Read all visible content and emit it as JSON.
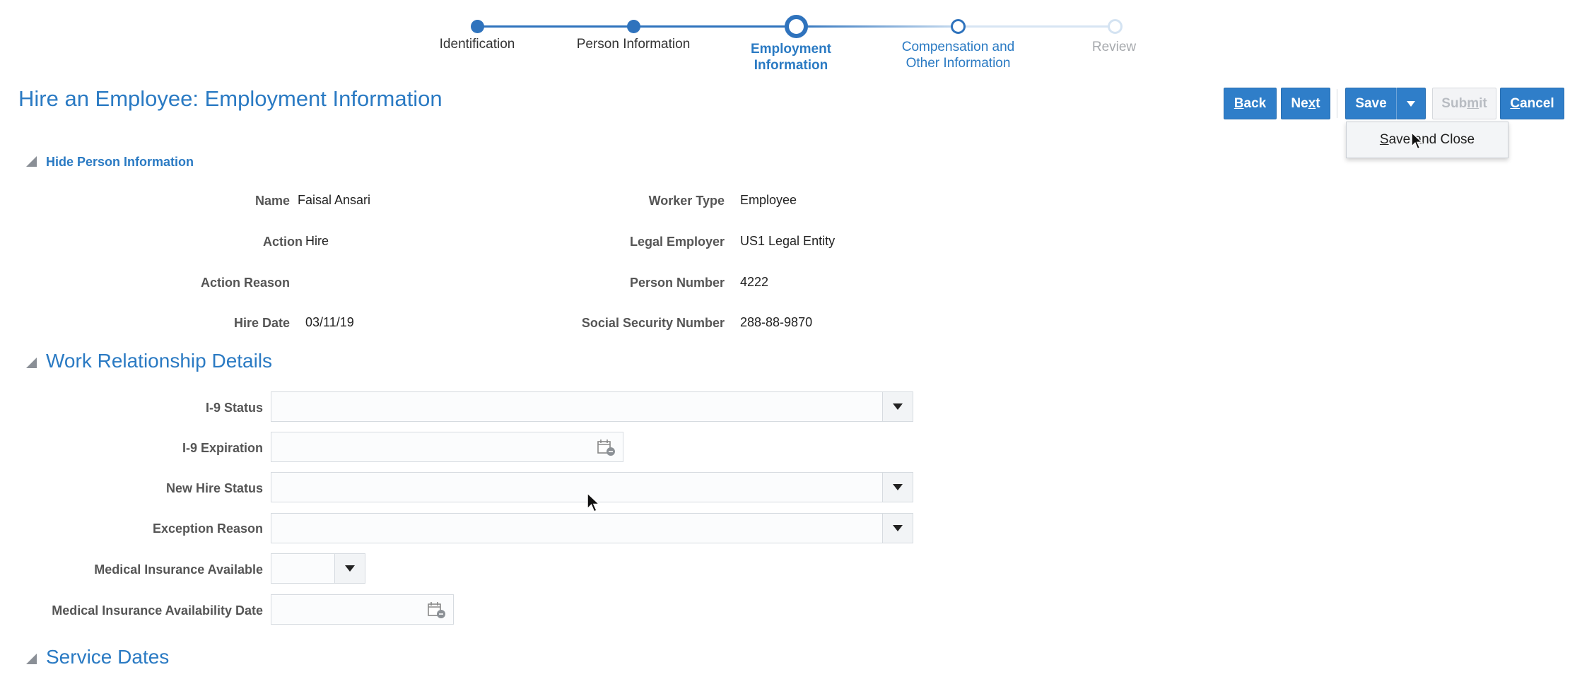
{
  "train": {
    "steps": [
      {
        "label": "Identification",
        "state": "done"
      },
      {
        "label": "Person Information",
        "state": "done"
      },
      {
        "label_line1": "Employment",
        "label_line2": "Information",
        "state": "current"
      },
      {
        "label_line1": "Compensation and",
        "label_line2": "Other Information",
        "state": "next"
      },
      {
        "label": "Review",
        "state": "disabled"
      }
    ]
  },
  "page": {
    "title": "Hire an Employee: Employment Information"
  },
  "toolbar": {
    "back": {
      "pre": "",
      "ul": "B",
      "post": "ack"
    },
    "next": {
      "pre": "Ne",
      "ul": "x",
      "post": "t"
    },
    "save": "Save",
    "submit": {
      "pre": "Sub",
      "ul": "m",
      "post": "it"
    },
    "cancel": {
      "pre": "",
      "ul": "C",
      "post": "ancel"
    },
    "save_menu": {
      "ul": "S",
      "post": "ave and Close"
    }
  },
  "person_section": {
    "toggle_label": "Hide Person Information",
    "left": [
      {
        "label": "Name",
        "value": "Faisal Ansari"
      },
      {
        "label": "Action",
        "value": "Hire"
      },
      {
        "label": "Action Reason",
        "value": ""
      },
      {
        "label": "Hire Date",
        "value": "03/11/19"
      }
    ],
    "right": [
      {
        "label": "Worker Type",
        "value": "Employee"
      },
      {
        "label": "Legal Employer",
        "value": "US1 Legal Entity"
      },
      {
        "label": "Person Number",
        "value": "4222"
      },
      {
        "label": "Social Security Number",
        "value": "288-88-9870"
      }
    ]
  },
  "work_relationship": {
    "heading": "Work Relationship Details",
    "fields": [
      {
        "label": "I-9 Status",
        "value": ""
      },
      {
        "label": "I-9 Expiration",
        "value": ""
      },
      {
        "label": "New Hire Status",
        "value": ""
      },
      {
        "label": "Exception Reason",
        "value": ""
      },
      {
        "label": "Medical Insurance Available",
        "value": ""
      },
      {
        "label": "Medical Insurance Availability Date",
        "value": ""
      }
    ]
  },
  "service_dates": {
    "heading": "Service Dates"
  },
  "colors": {
    "accent": "#2a7ac3",
    "button": "#2f7ec9",
    "disabled_text": "#b8bcc2"
  },
  "icons": [
    "calendar-icon",
    "dropdown-arrow-icon",
    "collapse-triangle-icon",
    "mouse-cursor-icon"
  ]
}
